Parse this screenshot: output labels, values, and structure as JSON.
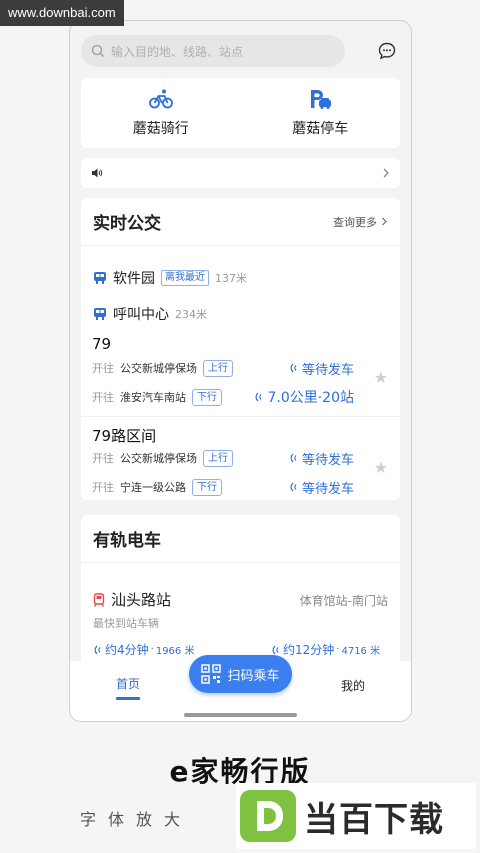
{
  "watermark": "www.downbai.com",
  "search": {
    "placeholder": "输入目的地、线路、站点"
  },
  "quick": [
    {
      "label": "蘑菇骑行",
      "icon": "bike-icon"
    },
    {
      "label": "蘑菇停车",
      "icon": "parking-icon"
    }
  ],
  "bus": {
    "title": "实时公交",
    "more": "查询更多",
    "stations": [
      {
        "name": "软件园",
        "tag": "离我最近",
        "distance": "137米"
      },
      {
        "name": "呼叫中心",
        "distance": "234米"
      }
    ],
    "routes": [
      {
        "number": "79",
        "directions": [
          {
            "prefix": "开往",
            "dest": "公交新城停保场",
            "tag": "上行",
            "status": "等待发车"
          },
          {
            "prefix": "开往",
            "dest": "淮安汽车南站",
            "tag": "下行",
            "status": "7.0公里·20站"
          }
        ]
      },
      {
        "number": "79路区间",
        "directions": [
          {
            "prefix": "开往",
            "dest": "公交新城停保场",
            "tag": "上行",
            "status": "等待发车"
          },
          {
            "prefix": "开往",
            "dest": "宁连一级公路",
            "tag": "下行",
            "status": "等待发车"
          }
        ]
      }
    ]
  },
  "tram": {
    "title": "有轨电车",
    "station": "汕头路站",
    "direction": "体育馆站-南门站",
    "sub": "最快到站车辆",
    "eta": [
      {
        "time": "约4分钟",
        "dist": "1966 米"
      },
      {
        "time": "约12分钟",
        "dist": "4716 米"
      }
    ]
  },
  "tabbar": {
    "home": "首页",
    "scan": "扫码乘车",
    "mine": "我的"
  },
  "caption": "e家畅行版",
  "subcaption": "字体放大",
  "logo": {
    "letter": "D",
    "text": "当百下载"
  },
  "colors": {
    "accent": "#3b7ef0",
    "tag_blue": "#2f6fd6",
    "logo_green": "#7fc241"
  }
}
